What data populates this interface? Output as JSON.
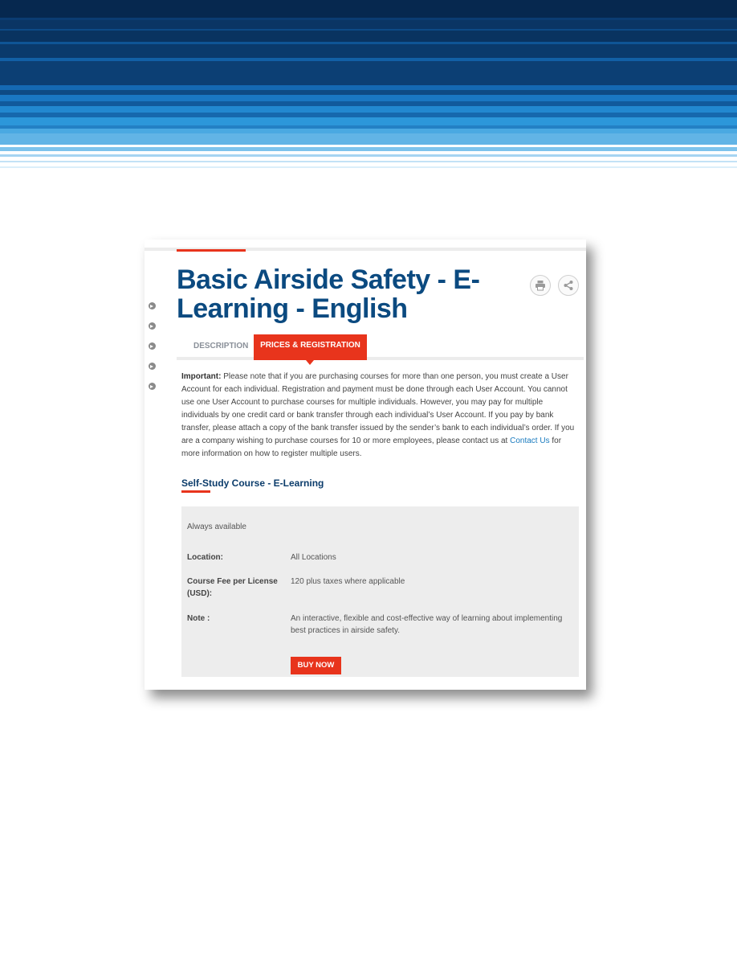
{
  "page": {
    "title": "Basic Airside Safety - E-Learning - English"
  },
  "toolbar": {
    "print_icon": "print-icon",
    "share_icon": "share-icon"
  },
  "tabs": [
    {
      "label": "DESCRIPTION",
      "active": false
    },
    {
      "label": "PRICES & REGISTRATION",
      "active": true
    }
  ],
  "important": {
    "label": "Important:",
    "text_before_link": " Please note that if you are purchasing courses for more than one person, you must create a User Account for each individual. Registration and payment must be done through each User Account. You cannot use one User Account to purchase courses for multiple individuals. However, you may pay for multiple individuals by one credit card or bank transfer through each individual’s User Account. If you pay by bank transfer, please attach a copy of the bank transfer issued by the sender’s bank to each individual’s order. If you are a company wishing to purchase courses for 10 or more employees, please contact us at ",
    "link_text": "Contact Us",
    "text_after_link": " for more information on how to register multiple users."
  },
  "course": {
    "heading": "Self-Study Course - E-Learning",
    "availability": "Always available",
    "location_label": "Location:",
    "location_value": "All Locations",
    "fee_label": "Course Fee per License (USD):",
    "fee_value": "120 plus taxes where applicable",
    "note_label": "Note :",
    "note_value": "An interactive, flexible and cost-effective way of learning about implementing best practices in airside safety.",
    "buy_label": "BUY NOW"
  },
  "colors": {
    "accent": "#e8341c",
    "title": "#0b4a80",
    "link": "#1a7bbf"
  }
}
